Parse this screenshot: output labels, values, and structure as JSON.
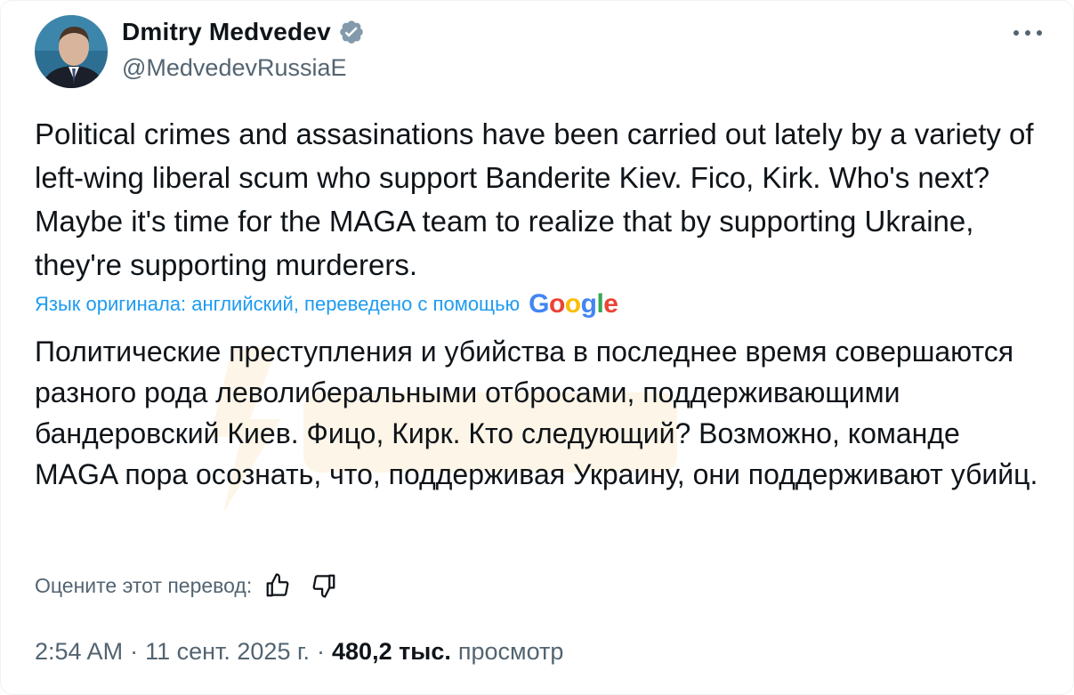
{
  "author": {
    "display_name": "Dmitry Medvedev",
    "handle": "@MedvedevRussiaE",
    "verified": true,
    "verified_color": "#1d9bf0"
  },
  "menu_icon": "more-horizontal-icon",
  "tweet": {
    "text_en": "Political crimes and assasinations have been carried out lately by a variety of left-wing liberal scum who support Banderite Kiev. Fico, Kirk. Who's next? Maybe it's time for the MAGA team to realize that by supporting Ukraine, they're supporting murderers.",
    "translation_note": "Язык оригинала: английский, переведено с помощью",
    "translation_provider": "Google",
    "text_ru": "Политические преступления и убийства в последнее время совершаются разного рода леволиберальными отбросами, поддерживающими бандеровский Киев. Фицо, Кирк. Кто следующий? Возможно, команде MAGA пора осознать, что, поддерживая Украину, они поддерживают убийц."
  },
  "rating": {
    "label": "Оцените этот перевод:",
    "up_icon": "thumbs-up-icon",
    "down_icon": "thumbs-down-icon"
  },
  "meta": {
    "time": "2:54 AM",
    "separator": "·",
    "date": "11 сент. 2025 г.",
    "views_count": "480,2 тыс.",
    "views_label": "просмотр"
  },
  "colors": {
    "text_primary": "#0f1419",
    "text_secondary": "#536471",
    "link_blue": "#1d9bf0"
  }
}
